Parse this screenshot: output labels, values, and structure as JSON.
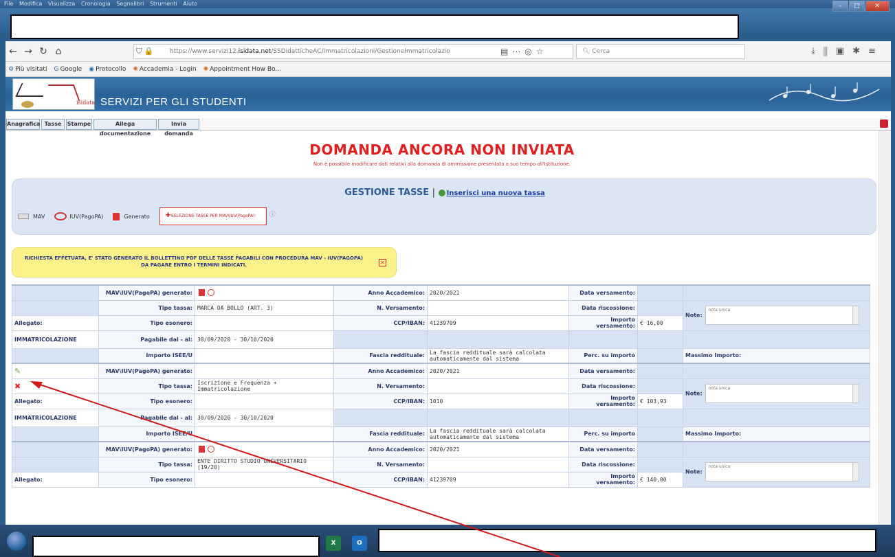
{
  "window": {
    "menu_items": [
      "File",
      "Modifica",
      "Visualizza",
      "Cronologia",
      "Segnalibri",
      "Strumenti",
      "Aiuto"
    ]
  },
  "browser": {
    "url_prefix": "https://www.servizi12.",
    "url_domain": "isidata.net",
    "url_path": "/SSDidatticheAC/Immatricolazioni/GestioneImmatricolazio",
    "search_placeholder": "Cerca",
    "bookmarks": [
      {
        "label": "Più visitati",
        "icon": "gear-icon"
      },
      {
        "label": "Google",
        "icon": "google-icon"
      },
      {
        "label": "Protocollo",
        "icon": "globe-icon"
      },
      {
        "label": "Accademia - Login",
        "icon": "accademia-icon"
      },
      {
        "label": "Appointment How Bo...",
        "icon": "accademia-icon"
      }
    ]
  },
  "site": {
    "logo_text": "isidata",
    "title": "SERVIZI PER GLI STUDENTI",
    "tabs": [
      "Anagrafica",
      "Tasse",
      "Stampe",
      "Allega documentazione",
      "Invia domanda"
    ]
  },
  "main": {
    "title": "DOMANDA ANCORA NON INVIATA",
    "subtitle": "Non è possibile modificare dati relativi alla domanda di ammissione presentata a suo tempo all'Istituzione."
  },
  "gestione": {
    "title": "GESTIONE TASSE",
    "separator": "|",
    "link": "Inserisci una nuova tassa",
    "legend": {
      "mav": "MAV",
      "iuv": "IUV(PagoPA)",
      "generato": "Generato",
      "selezione": "SELEZIONE TASSE PER MAV\\IUV(PagoPA)"
    }
  },
  "notice": {
    "text": "RICHIESTA EFFETUATA, E' STATO GENERATO IL BOLLETTINO PDF DELLE TASSE PAGABILI CON PROCEDURA MAV - IUV(PAGOPA) DA PAGARE ENTRO I TERMINI INDICATI."
  },
  "labels": {
    "mav_generato": "MAV\\IUV(PagoPA) generato:",
    "anno": "Anno Accademico:",
    "data_versamento": "Data versamento:",
    "tipo_tassa": "Tipo tassa:",
    "n_versamento": "N. Versamento:",
    "data_riscossione": "Data riscossione:",
    "note": "Note:",
    "allegato": "Allegato:",
    "tipo_esonero": "Tipo esonero:",
    "ccp": "CCP/IBAN:",
    "importo_versamento": "Importo versamento:",
    "pagabile": "Pagabile dal - al:",
    "importo_isee": "Importo ISEE/U",
    "fascia": "Fascia reddituale:",
    "perc": "Perc. su importo",
    "massimo": "Massimo Importo:",
    "immatricolazione": "IMMATRICOLAZIONE"
  },
  "taxes": [
    {
      "anno": "2020/2021",
      "tipo_tassa": "MARCA DA BOLLO (ART. 3)",
      "ccp": "41239709",
      "importo": "€ 16,00",
      "pagabile": "30/09/2020 - 30/10/2020",
      "fascia": "La fascia reddituale sarà calcolata automaticamente dal sistema",
      "note_placeholder": "nota unica"
    },
    {
      "anno": "2020/2021",
      "tipo_tassa": "Iscrizione e Frequenza + Immatricolazione",
      "ccp": "1010",
      "importo": "€ 103,93",
      "pagabile": "30/09/2020 - 30/10/2020",
      "fascia": "La fascia reddituale sarà calcolata automaticamente dal sistema",
      "note_placeholder": "nota unica"
    },
    {
      "anno": "2020/2021",
      "tipo_tassa": "ENTE DIRITTO STUDIO UNIVERSITARIO (19/20)",
      "ccp": "41239709",
      "importo": "€ 140,00",
      "note_placeholder": "nota unica"
    }
  ],
  "colors": {
    "accent_red": "#e02020",
    "banner_blue": "#2a6297",
    "panel_blue": "#dbe5f4",
    "notice_yellow": "#fdf28a",
    "arrow_red": "#d01818"
  }
}
